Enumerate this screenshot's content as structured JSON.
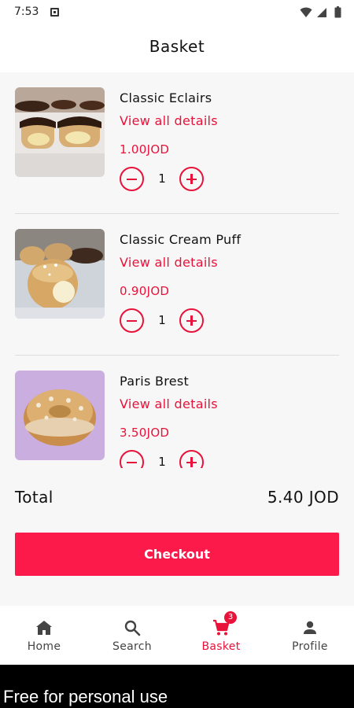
{
  "status_bar": {
    "time": "7:53"
  },
  "header": {
    "title": "Basket"
  },
  "basket": {
    "details_label": "View all details",
    "items": [
      {
        "name": "Classic Eclairs",
        "price": "1.00JOD",
        "quantity": "1",
        "image": "eclairs"
      },
      {
        "name": "Classic Cream Puff",
        "price": "0.90JOD",
        "quantity": "1",
        "image": "cream-puff"
      },
      {
        "name": "Paris Brest",
        "price": "3.50JOD",
        "quantity": "1",
        "image": "paris-brest"
      }
    ]
  },
  "summary": {
    "total_label": "Total",
    "total_value": "5.40 JOD"
  },
  "checkout": {
    "label": "Checkout"
  },
  "nav": {
    "items": [
      {
        "label": "Home",
        "icon": "home-icon"
      },
      {
        "label": "Search",
        "icon": "search-icon"
      },
      {
        "label": "Basket",
        "icon": "cart-icon",
        "badge": "3",
        "active": true
      },
      {
        "label": "Profile",
        "icon": "person-icon"
      }
    ]
  },
  "footer": {
    "watermark": "Free for personal use"
  },
  "colors": {
    "accent": "#e8123a",
    "button": "#fb1a49",
    "background": "#f7f7f7"
  }
}
